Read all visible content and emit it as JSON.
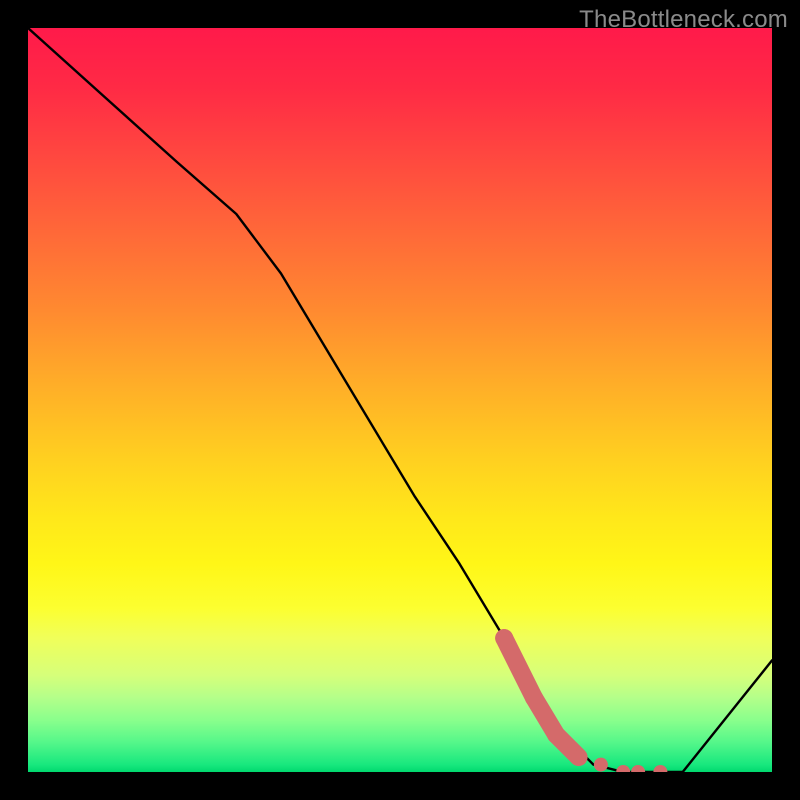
{
  "attribution": "TheBottleneck.com",
  "colors": {
    "curve": "#000000",
    "marker": "#d46a6a",
    "frame": "#000000"
  },
  "chart_data": {
    "type": "line",
    "title": "",
    "xlabel": "",
    "ylabel": "",
    "xlim": [
      0,
      100
    ],
    "ylim": [
      0,
      100
    ],
    "grid": false,
    "series": [
      {
        "name": "bottleneck-curve",
        "x": [
          0,
          10,
          20,
          28,
          34,
          40,
          46,
          52,
          58,
          64,
          68,
          72,
          76,
          80,
          84,
          88,
          100
        ],
        "y": [
          100,
          91,
          82,
          75,
          67,
          57,
          47,
          37,
          28,
          18,
          11,
          5,
          1,
          0,
          0,
          0,
          15
        ]
      }
    ],
    "highlight_range": {
      "name": "optimal-zone",
      "x": [
        64,
        68,
        71,
        74,
        77,
        80,
        82,
        85
      ],
      "y": [
        18,
        10,
        5,
        2,
        1,
        0,
        0,
        0
      ]
    }
  }
}
